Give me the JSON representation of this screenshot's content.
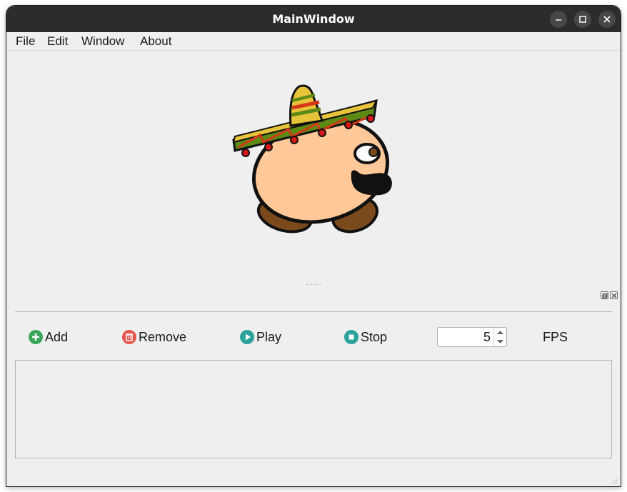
{
  "window": {
    "title": "MainWindow"
  },
  "menu": {
    "items": [
      "File",
      "Edit",
      "Window",
      "About"
    ]
  },
  "toolbar": {
    "add_label": "Add",
    "remove_label": "Remove",
    "play_label": "Play",
    "stop_label": "Stop",
    "fps_value": "5",
    "fps_label": "FPS"
  },
  "icons": {
    "add": "plus-circle-icon",
    "remove": "trash-icon",
    "play": "play-icon",
    "stop": "stop-icon"
  },
  "colors": {
    "titlebar": "#2c2c2c",
    "add": "#3aa65a",
    "remove": "#e5534b",
    "play": "#2ba39a",
    "stop": "#2ba39a",
    "skin": "#ffc898",
    "boots": "#7a4a1c"
  }
}
